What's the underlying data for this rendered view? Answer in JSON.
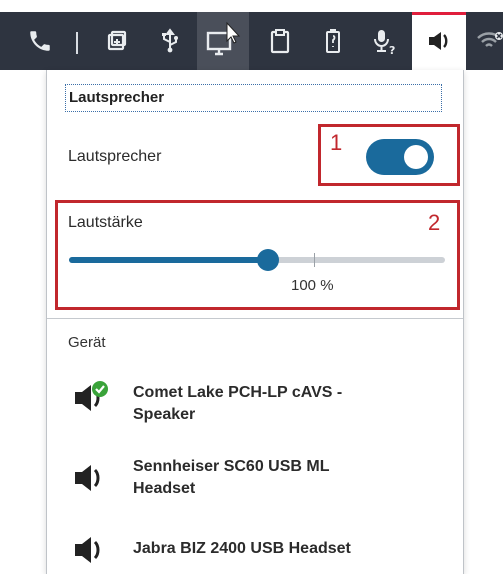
{
  "toolbar": {
    "icons": [
      "phone-icon",
      "dialpad-icon",
      "usb-icon",
      "monitor-icon",
      "clipboard-icon",
      "battery-icon",
      "microphone-icon",
      "speaker-icon",
      "wifi-icon"
    ],
    "active": "speaker-icon"
  },
  "panel": {
    "title": "Lautsprecher",
    "speaker_label": "Lautsprecher",
    "speaker_enabled": true,
    "volume_label": "Lautstärke",
    "volume_percent": 53,
    "volume_text": "100 %",
    "device_label": "Gerät",
    "devices": [
      {
        "name_line1": "Comet Lake PCH-LP cAVS -",
        "name_line2": "Speaker",
        "selected": true,
        "icon": "speaker-check-icon"
      },
      {
        "name_line1": "Sennheiser SC60 USB ML",
        "name_line2": "Headset",
        "selected": false,
        "icon": "speaker-icon"
      },
      {
        "name_line1": "Jabra BIZ 2400 USB Headset",
        "name_line2": "",
        "selected": false,
        "icon": "speaker-icon"
      }
    ]
  },
  "annotations": [
    "1",
    "2"
  ],
  "colors": {
    "accent": "#1a6a9c",
    "toolbar": "#2e3440",
    "annotation": "#c1272d",
    "active_tab_border": "#e01e3c",
    "check": "#3aa33a"
  }
}
